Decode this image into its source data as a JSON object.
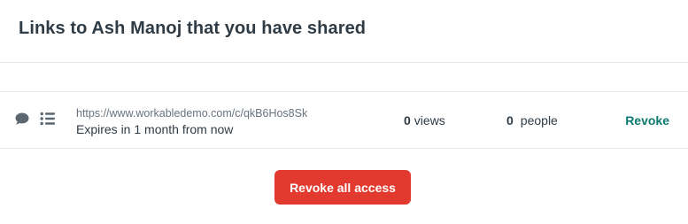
{
  "header": {
    "title": "Links to Ash Manoj that you have shared"
  },
  "links": [
    {
      "icons": [
        "comment-icon",
        "list-icon"
      ],
      "url": "https://www.workabledemo.com/c/qkB6Hos8Sk",
      "expiry": "Expires in 1 month from now",
      "views_count": "0",
      "views_label": "views",
      "people_count": "0",
      "people_label": "people",
      "revoke_label": "Revoke"
    }
  ],
  "footer": {
    "revoke_all_label": "Revoke all access"
  },
  "colors": {
    "text": "#2f3b45",
    "muted": "#69737d",
    "accent": "#0b7a6e",
    "danger": "#e23a2e",
    "icon": "#5b6770",
    "divider": "#e6e8eb"
  }
}
